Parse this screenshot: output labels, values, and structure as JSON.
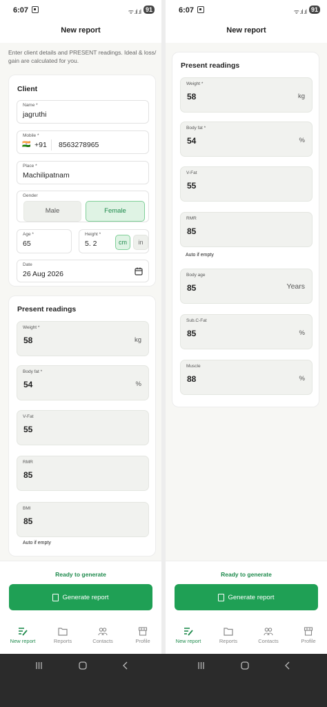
{
  "status": {
    "time": "6:07",
    "signal": "ᯤ .ıl .ıl",
    "battery": "91"
  },
  "app": {
    "title": "New report"
  },
  "intro_text": "Enter client details and PRESENT readings. Ideal & loss/ gain are calculated for you.",
  "client": {
    "title": "Client",
    "name_label": "Name *",
    "name_value": "jagruthi",
    "mobile_label": "Mobile *",
    "flag": "🇮🇳",
    "country_code": "+91",
    "mobile_value": "8563278965",
    "place_label": "Place *",
    "place_value": "Machilipatnam",
    "gender_label": "Gender",
    "gender_options": [
      "Male",
      "Female"
    ],
    "gender_selected": "Female",
    "age_label": "Age *",
    "age_value": "65",
    "height_label": "Height *",
    "height_value": "5. 2",
    "height_units": [
      "cm",
      "in"
    ],
    "height_unit_selected": "cm",
    "date_label": "Date",
    "date_value": "26 Aug 2026"
  },
  "readings_left": {
    "title": "Present readings",
    "items": [
      {
        "label": "Weight *",
        "value": "58",
        "unit": "kg"
      },
      {
        "label": "Body fat *",
        "value": "54",
        "unit": "%"
      },
      {
        "label": "V-Fat",
        "value": "55",
        "unit": ""
      },
      {
        "label": "RMR",
        "value": "85",
        "unit": ""
      },
      {
        "label": "BMI",
        "value": "85",
        "unit": ""
      }
    ],
    "hint": "Auto if empty"
  },
  "readings_right": {
    "title": "Present readings",
    "items": [
      {
        "label": "Weight *",
        "value": "58",
        "unit": "kg"
      },
      {
        "label": "Body fat *",
        "value": "54",
        "unit": "%"
      },
      {
        "label": "V-Fat",
        "value": "55",
        "unit": ""
      },
      {
        "label": "RMR",
        "value": "85",
        "unit": ""
      },
      {
        "label": "Body age",
        "value": "85",
        "unit": "Years"
      },
      {
        "label": "Sub.C-Fat",
        "value": "85",
        "unit": "%"
      },
      {
        "label": "Muscle",
        "value": "88",
        "unit": "%"
      }
    ],
    "hint": "Auto if empty"
  },
  "footer": {
    "ready_text": "Ready to generate",
    "generate_label": "Generate report"
  },
  "tabs": [
    {
      "label": "New report",
      "icon": "edit-list-icon",
      "active": true
    },
    {
      "label": "Reports",
      "icon": "folder-icon",
      "active": false
    },
    {
      "label": "Contacts",
      "icon": "people-icon",
      "active": false
    },
    {
      "label": "Profile",
      "icon": "store-icon",
      "active": false
    }
  ],
  "colors": {
    "accent": "#1fa055",
    "accent_text": "#1e8a4c",
    "selected_bg": "#dff3e4"
  }
}
